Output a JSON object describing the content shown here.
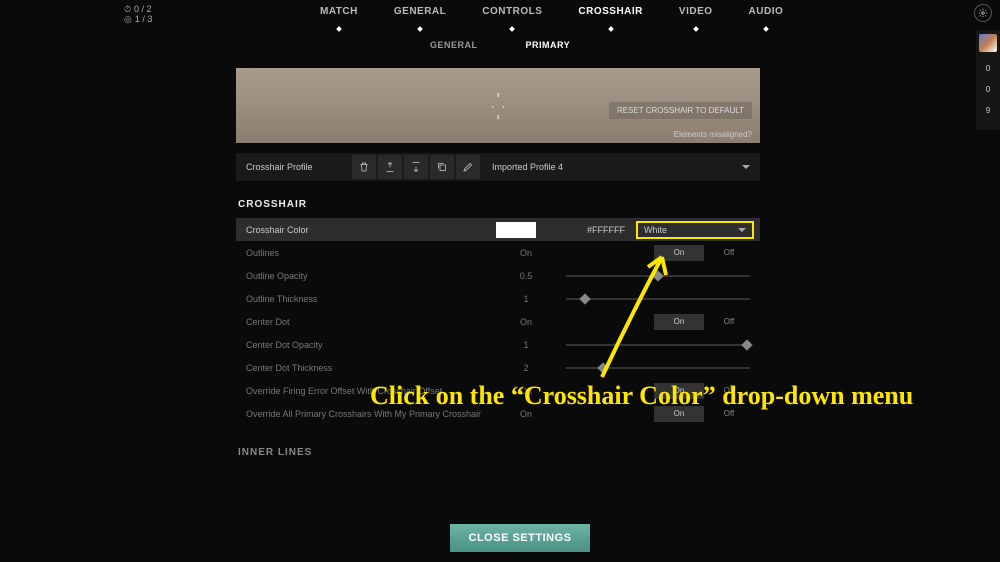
{
  "score": {
    "top": "0 / 2",
    "bottom": "1 / 3"
  },
  "nav": {
    "match": "MATCH",
    "general": "GENERAL",
    "controls": "CONTROLS",
    "crosshair": "CROSSHAIR",
    "video": "VIDEO",
    "audio": "AUDIO"
  },
  "subnav": {
    "general": "GENERAL",
    "primary": "PRIMARY"
  },
  "preview": {
    "reset": "RESET CROSSHAIR TO DEFAULT",
    "misaligned": "Elements misaligned?"
  },
  "profile": {
    "label": "Crosshair Profile",
    "selected": "Imported Profile 4"
  },
  "section1": "CROSSHAIR",
  "crosshairColor": {
    "label": "Crosshair Color",
    "hex": "#FFFFFF",
    "value": "White"
  },
  "rows": {
    "outlines": {
      "label": "Outlines",
      "value": "On",
      "off": "Off"
    },
    "outlineOpacity": {
      "label": "Outline Opacity",
      "value": "0.5"
    },
    "outlineThickness": {
      "label": "Outline Thickness",
      "value": "1"
    },
    "centerDot": {
      "label": "Center Dot",
      "value": "On",
      "off": "Off"
    },
    "centerDotOpacity": {
      "label": "Center Dot Opacity",
      "value": "1"
    },
    "centerDotThickness": {
      "label": "Center Dot Thickness",
      "value": "2"
    },
    "overrideFE": {
      "label": "Override Firing Error Offset With Crosshair Offset",
      "value": "On",
      "off": "Off"
    },
    "overrideAll": {
      "label": "Override All Primary Crosshairs With My Primary Crosshair",
      "value": "On",
      "off": "Off"
    }
  },
  "section2": "INNER LINES",
  "sidebar": {
    "v1": "0",
    "v2": "0",
    "v3": "9"
  },
  "closeBtn": "CLOSE SETTINGS",
  "annotation": "Click on the “Crosshair Color” drop-down menu"
}
